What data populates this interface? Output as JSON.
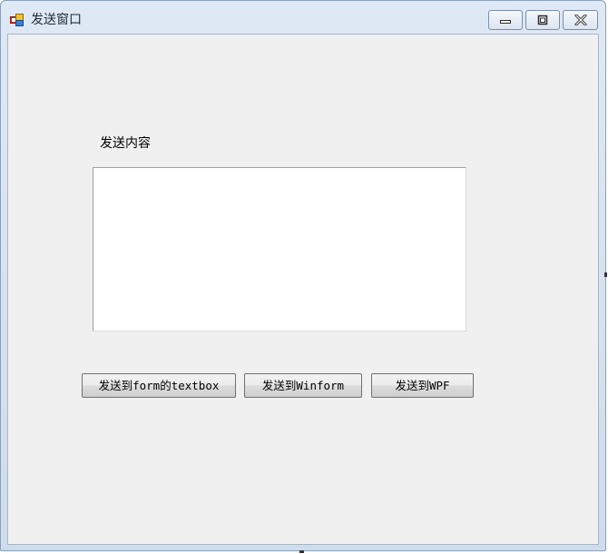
{
  "window": {
    "title": "发送窗口",
    "icon": "winforms-app-icon",
    "controls": {
      "minimize_icon": "minimize-icon",
      "maximize_icon": "maximize-icon",
      "close_icon": "close-icon"
    }
  },
  "form": {
    "content_label": "发送内容",
    "content_value": "",
    "buttons": {
      "send_form_textbox": "发送到form的textbox",
      "send_winform": "发送到Winform",
      "send_wpf": "发送到WPF"
    }
  },
  "colors": {
    "client_bg": "#f0f0f0",
    "frame": "#dfe9f5",
    "textbox_bg": "#ffffff"
  }
}
